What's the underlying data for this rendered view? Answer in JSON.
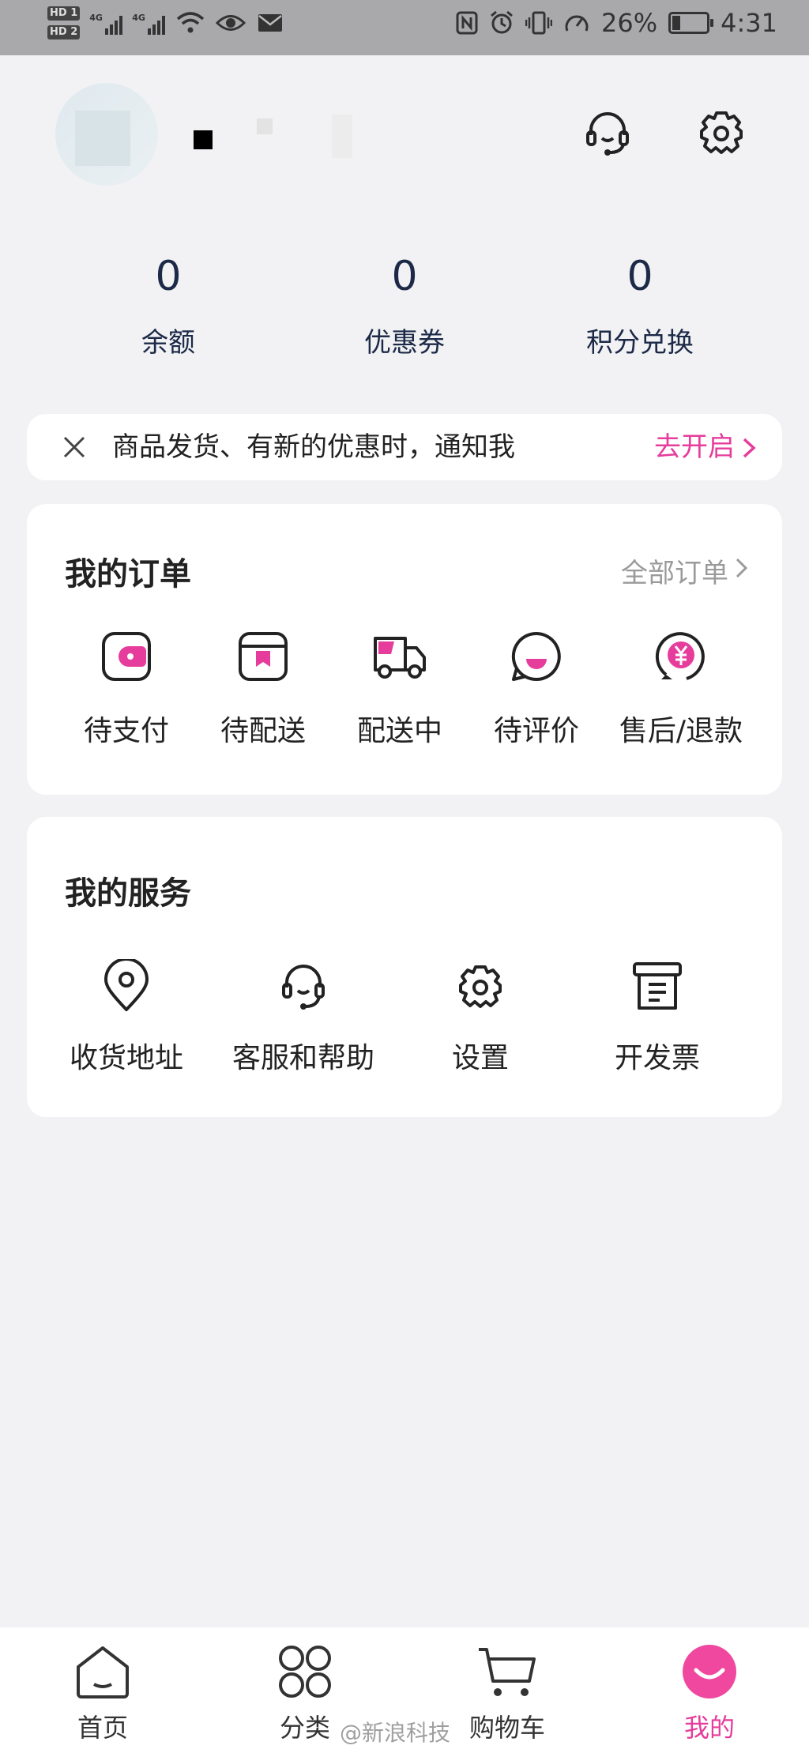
{
  "status_bar": {
    "left_labels": [
      "HD 1",
      "HD 2",
      "4G",
      "4G"
    ],
    "battery": "26%",
    "time": "4:31"
  },
  "header": {
    "avatar": "avatar",
    "customer_service_icon": "headset-icon",
    "settings_icon": "gear-icon"
  },
  "stats": [
    {
      "value": "0",
      "label": "余额"
    },
    {
      "value": "0",
      "label": "优惠券"
    },
    {
      "value": "0",
      "label": "积分兑换"
    }
  ],
  "notice": {
    "text": "商品发货、有新的优惠时，通知我",
    "action": "去开启"
  },
  "orders": {
    "title": "我的订单",
    "all_label": "全部订单",
    "items": [
      {
        "label": "待支付",
        "icon": "wallet-icon"
      },
      {
        "label": "待配送",
        "icon": "package-icon"
      },
      {
        "label": "配送中",
        "icon": "truck-icon"
      },
      {
        "label": "待评价",
        "icon": "smile-bubble-icon"
      },
      {
        "label": "售后/退款",
        "icon": "refund-icon"
      }
    ]
  },
  "services": {
    "title": "我的服务",
    "items": [
      {
        "label": "收货地址",
        "icon": "location-pin-icon"
      },
      {
        "label": "客服和帮助",
        "icon": "headset-icon"
      },
      {
        "label": "设置",
        "icon": "gear-icon"
      },
      {
        "label": "开发票",
        "icon": "invoice-icon"
      }
    ]
  },
  "tabbar": {
    "items": [
      {
        "label": "首页",
        "icon": "home-icon"
      },
      {
        "label": "分类",
        "icon": "grid-icon"
      },
      {
        "label": "购物车",
        "icon": "cart-icon"
      },
      {
        "label": "我的",
        "icon": "smile-face-icon"
      }
    ],
    "active_index": 3
  },
  "watermark": "@新浪科技",
  "colors": {
    "accent": "#e63c9c",
    "stat_text": "#1c2a48",
    "background": "#f2f2f4"
  }
}
